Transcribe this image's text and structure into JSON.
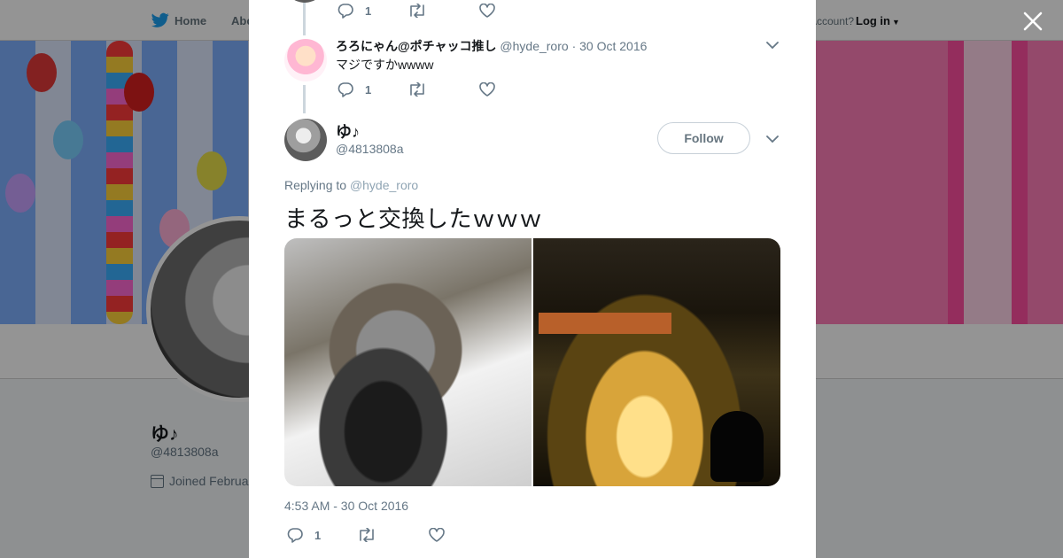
{
  "nav": {
    "home_label": "Home",
    "about_label": "Abo",
    "account_prompt": "Account?",
    "login_label": "Log in"
  },
  "profile": {
    "name": "ゆ♪",
    "handle": "@4813808a",
    "joined": "Joined Februa"
  },
  "thread": {
    "previous_tweet": {
      "reply_count": "1"
    },
    "reply_tweet": {
      "display_name": "ろろにゃん@ポチャッコ推し",
      "handle": "@hyde_roro",
      "separator": "·",
      "date": "30 Oct 2016",
      "text": "マジですかwwww",
      "reply_count": "1"
    },
    "main_tweet": {
      "display_name": "ゆ♪",
      "handle": "@4813808a",
      "follow_label": "Follow",
      "replying_to_prefix": "Replying to",
      "replying_to_handle": "@hyde_roro",
      "text": "まるっと交換したｗｗｗ",
      "timestamp": "4:53 AM - 30 Oct 2016",
      "reply_count": "1"
    }
  },
  "icons": {
    "bird": "twitter-bird-icon",
    "close": "close-icon",
    "reply": "reply-icon",
    "retweet": "retweet-icon",
    "like": "heart-icon",
    "caret": "chevron-down-icon",
    "calendar": "calendar-icon"
  },
  "colors": {
    "brand_blue": "#1da1f2",
    "muted_text": "#657786",
    "primary_text": "#14171a",
    "link_muted": "#8fa4b3"
  }
}
